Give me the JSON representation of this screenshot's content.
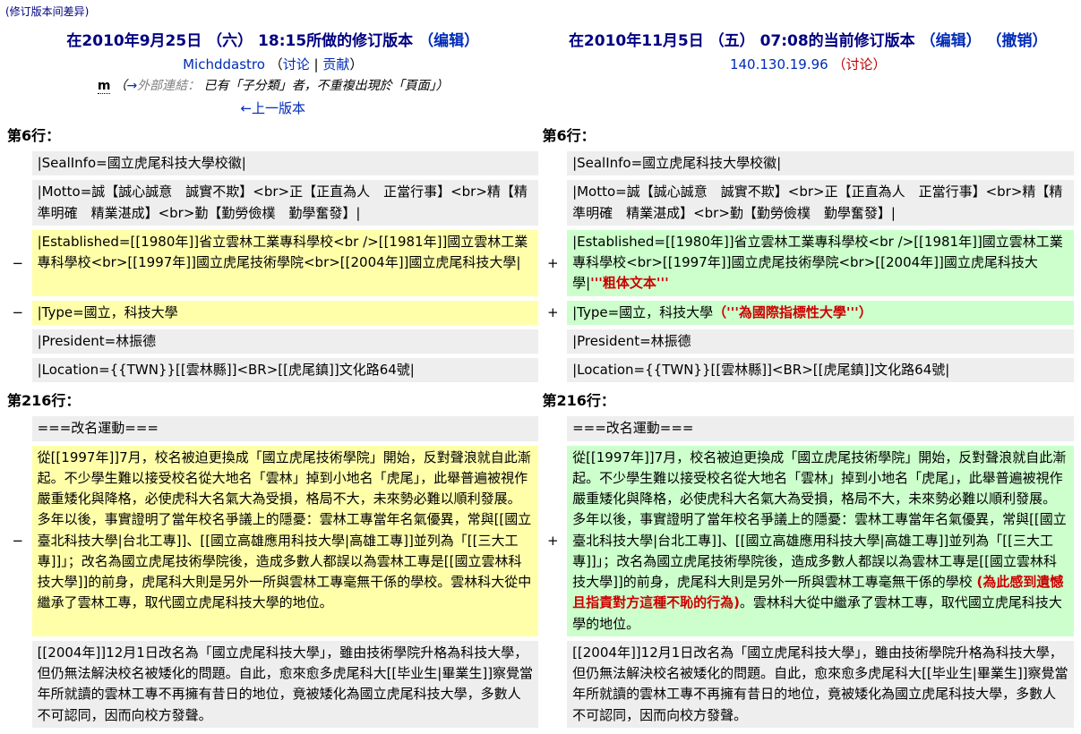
{
  "colors": {
    "header_navy": "#000080",
    "link_blue": "#002bb8",
    "red_link": "#ba0000",
    "autocomment_gray": "#808080",
    "context_bg": "#eeeeee",
    "deleted_bg": "#ffffaa",
    "added_bg": "#ccffcc",
    "diff_change_red": "#cc0000"
  },
  "page": {
    "subtitle": "(修订版本间差异)"
  },
  "header": {
    "old": {
      "title": "在2010年9月25日 （六） 18:15所做的修订版本",
      "edit_link": "（编辑）",
      "user": "Michddastro",
      "userlinks_open": "（",
      "talk_link": "讨论",
      "userlinks_sep": " | ",
      "contribs_link": "贡献",
      "userlinks_close": "）",
      "minor_mark": "m",
      "comment_open": "（",
      "autocomment_arrow": "→",
      "autocomment_text": "外部連結：",
      "comment_text": " 已有「子分類」者，不重複出現於「頁面」",
      "comment_close": "）",
      "prev_link": "←上一版本"
    },
    "new": {
      "title": "在2010年11月5日 （五） 07:08的当前修订版本",
      "edit_link": "（编辑）",
      "undo_link": "（撤销）",
      "user": "140.130.19.96",
      "talk_link": "（讨论）"
    }
  },
  "diff": {
    "deleted_marker": "−",
    "added_marker": "+",
    "rows": [
      {
        "h": [
          "第6行：",
          "第6行："
        ]
      },
      {
        "ctx": "|SealInfo=國立虎尾科技大學校徽|"
      },
      {
        "ctx": "|Motto=誠【誠心誠意　誠實不欺】<br>正【正直為人　正當行事】<br>精【精準明確　精業湛成】<br>勤【勤勞儉樸　勤學奮發】|"
      },
      {
        "del": [
          {
            "t": "|Established=[[1980年]]省立雲林工業專科學校<br />[[1981年]]國立雲林工業專科學校<br>[[1997年]]國立虎尾技術學院<br>[[2004年]]國立虎尾科技大學|"
          }
        ],
        "add": [
          {
            "t": "|Established=[[1980年]]省立雲林工業專科學校<br />[[1981年]]國立雲林工業專科學校<br>[[1997年]]國立虎尾技術學院<br>[[2004年]]國立虎尾科技大學|"
          },
          {
            "t": "'''粗体文本'''",
            "c": true
          }
        ]
      },
      {
        "del": [
          {
            "t": "|Type=國立，科技大學"
          }
        ],
        "add": [
          {
            "t": "|Type=國立，科技大學"
          },
          {
            "t": "（'''為國際指標性大學'''）",
            "c": true
          }
        ]
      },
      {
        "ctx": "|President=林振德"
      },
      {
        "ctx": "|Location={{TWN}}[[雲林縣]]<BR>[[虎尾鎮]]文化路64號|"
      },
      {
        "h": [
          "第216行：",
          "第216行："
        ]
      },
      {
        "ctx": "===改名運動==="
      },
      {
        "del": [
          {
            "t": "從[[1997年]]7月，校名被迫更換成「國立虎尾技術學院」開始，反對聲浪就自此漸起。不少學生難以接受校名從大地名「雲林」掉到小地名「虎尾」，此舉普遍被視作嚴重矮化與降格，必使虎科大名氣大為受損，格局不大，未來勢必難以順利發展。多年以後，事實證明了當年校名爭議上的隱憂：雲林工專當年名氣優異，常與[[國立臺北科技大學|台北工專]]、[[國立高雄應用科技大學|高雄工專]]並列為「[[三大工專]]」；改名為國立虎尾技術學院後，造成多數人都誤以為雲林工專是[[國立雲林科技大學]]的前身，虎尾科大則是另外一所與雲林工專毫無干係的學校。雲林科大從中繼承了雲林工專，取代國立虎尾科技大學的地位。"
          }
        ],
        "add": [
          {
            "t": "從[[1997年]]7月，校名被迫更換成「國立虎尾技術學院」開始，反對聲浪就自此漸起。不少學生難以接受校名從大地名「雲林」掉到小地名「虎尾」，此舉普遍被視作嚴重矮化與降格，必使虎科大名氣大為受損，格局不大，未來勢必難以順利發展。多年以後，事實證明了當年校名爭議上的隱憂：雲林工專當年名氣優異，常與[[國立臺北科技大學|台北工專]]、[[國立高雄應用科技大學|高雄工專]]並列為「[[三大工專]]」；改名為國立虎尾技術學院後，造成多數人都誤以為雲林工專是[[國立雲林科技大學]]的前身，虎尾科大則是另外一所與雲林工專毫無干係的學校 "
          },
          {
            "t": "(為此感到遺憾且指責對方這種不恥的行為)",
            "c": true
          },
          {
            "t": "。雲林科大從中繼承了雲林工專，取代國立虎尾科技大學的地位。"
          }
        ]
      },
      {
        "ctx": "[[2004年]]12月1日改名為「國立虎尾科技大學」，雖由技術學院升格為科技大學，但仍無法解決校名被矮化的問題。自此，愈來愈多虎尾科大[[毕业生|畢業生]]察覺當年所就讀的雲林工專不再擁有昔日的地位，竟被矮化為國立虎尾科技大學，多數人不可認同，因而向校方發聲。"
      }
    ]
  }
}
